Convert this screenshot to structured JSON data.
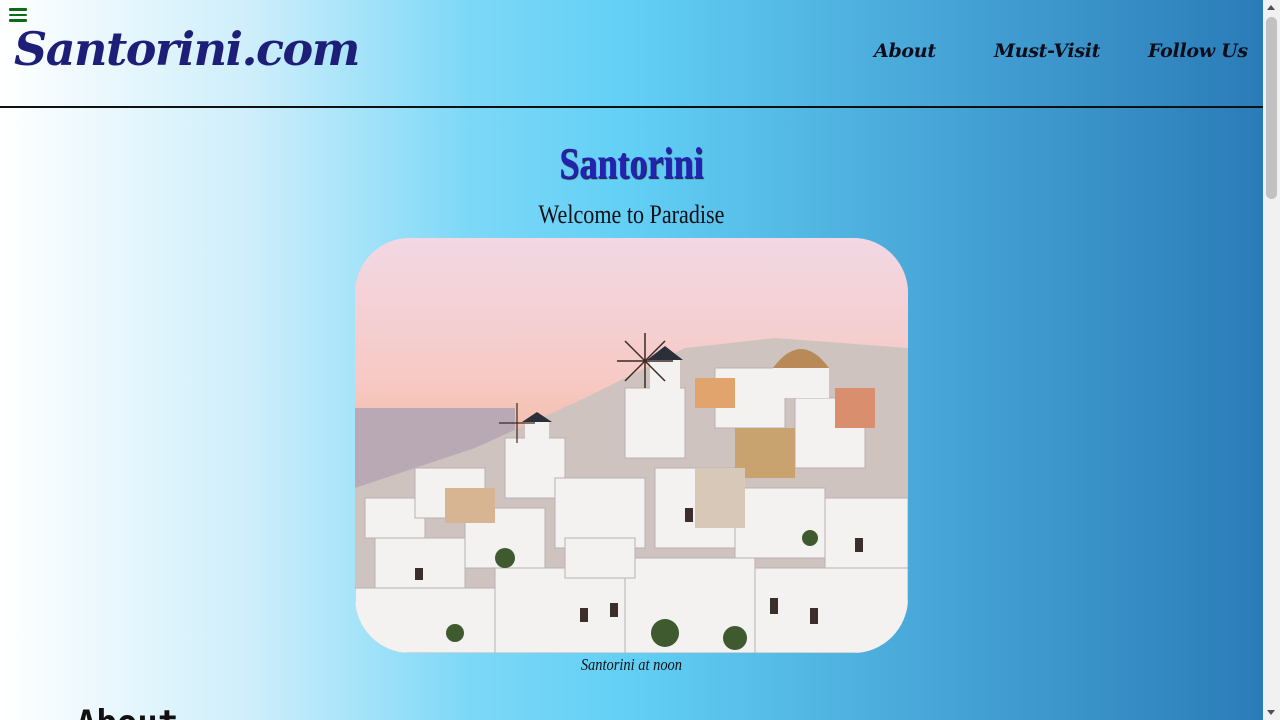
{
  "header": {
    "menu_icon": "hamburger-icon",
    "brand": "Santorini.com",
    "nav": [
      {
        "label": "About"
      },
      {
        "label": "Must-Visit"
      },
      {
        "label": "Follow Us"
      }
    ]
  },
  "hero": {
    "title": "Santorini",
    "subtitle": "Welcome to Paradise",
    "image_caption": "Santorini at noon"
  },
  "sections": {
    "about_heading": "About"
  },
  "colors": {
    "brand": "#1d1e78",
    "title": "#2323b0",
    "menu_icon": "#0c6b16"
  }
}
